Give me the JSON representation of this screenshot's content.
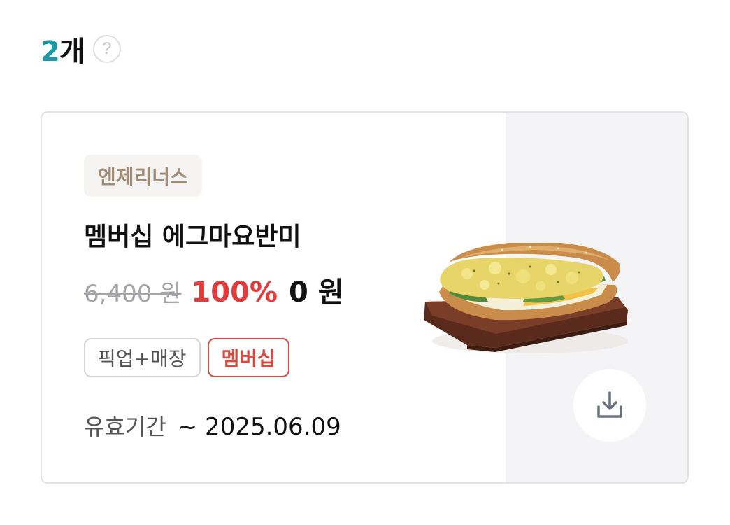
{
  "header": {
    "count_number": "2",
    "count_unit": "개",
    "help_symbol": "?"
  },
  "coupon": {
    "brand": "엔제리너스",
    "title": "멤버십 에그마요반미",
    "original_price": "6,400 원",
    "discount": "100%",
    "final_price": "0 원",
    "badges": [
      "픽업+매장",
      "멤버십"
    ],
    "validity_label": "유효기간",
    "validity_date": "~ 2025.06.09",
    "image_icon": "egg-mayo-banh-mi-sandwich",
    "download_icon": "download-icon"
  },
  "colors": {
    "accent_teal": "#1a9aa5",
    "discount_red": "#e53a3a",
    "badge_red": "#d9493d",
    "brand_tag_text": "#a08b77"
  }
}
